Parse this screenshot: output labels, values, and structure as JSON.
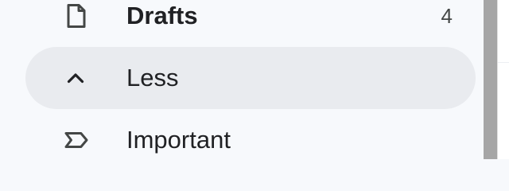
{
  "sidebar": {
    "items": [
      {
        "label": "Drafts",
        "count": "4",
        "icon": "file-icon",
        "active": false,
        "bold": true
      },
      {
        "label": "Less",
        "icon": "chevron-up-icon",
        "active": true,
        "bold": false
      },
      {
        "label": "Important",
        "icon": "important-label-icon",
        "active": false,
        "bold": false
      }
    ]
  },
  "colors": {
    "sidebar_background": "#f7f9fc",
    "active_item_background": "#e9ebef",
    "text": "#202124",
    "icon": "#444746",
    "scrollbar": "#a6a6a6",
    "right_pane": "#ffffff"
  }
}
